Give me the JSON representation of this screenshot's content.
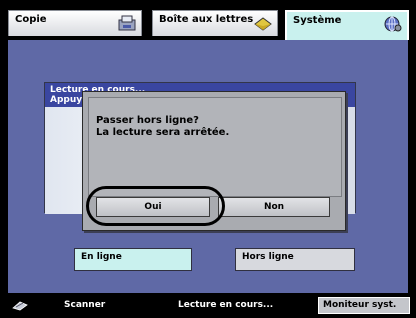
{
  "tabs": [
    {
      "label": "Copie",
      "icon": "copy-icon",
      "active": false
    },
    {
      "label": "Boîte aux lettres",
      "icon": "mailbox-icon",
      "active": false
    },
    {
      "label": "Système",
      "icon": "system-globe-icon",
      "active": true
    }
  ],
  "background_panel": {
    "line1": "Lecture en cours...",
    "line2": "Appuye"
  },
  "dialog": {
    "message_line1": "Passer hors ligne?",
    "message_line2": "La lecture sera arrêtée.",
    "yes_label": "Oui",
    "no_label": "Non"
  },
  "mode_buttons": {
    "online": "En ligne",
    "offline": "Hors ligne"
  },
  "statusbar": {
    "mode": "Scanner",
    "status": "Lecture en cours...",
    "monitor_label": "Moniteur syst."
  },
  "colors": {
    "workspace": "#5f69a6",
    "active_tab": "#c9f1ee",
    "dialog": "#a9abb0"
  }
}
